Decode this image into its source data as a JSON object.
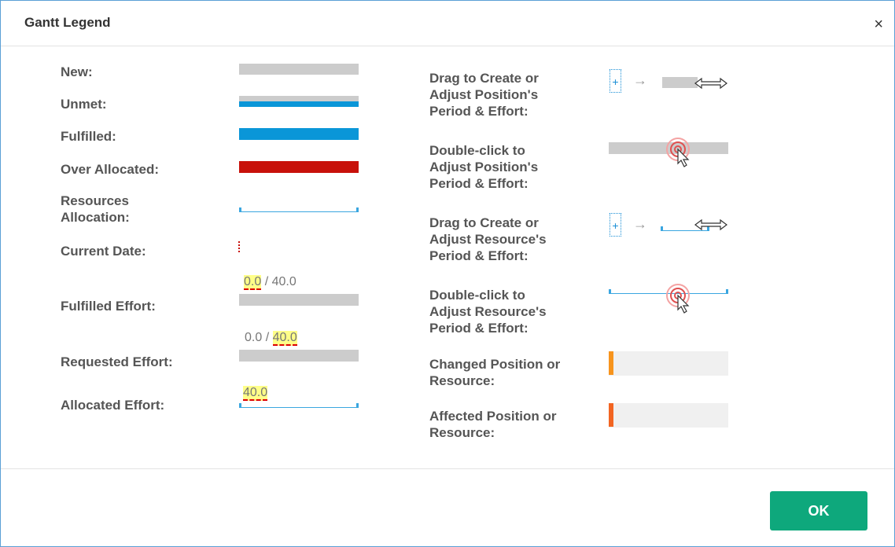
{
  "dialog": {
    "title": "Gantt Legend",
    "close_label": "×",
    "ok_label": "OK"
  },
  "left": {
    "new": "New:",
    "unmet": "Unmet:",
    "fulfilled": "Fulfilled:",
    "over_allocated": "Over Allocated:",
    "resources_allocation_1": "Resources",
    "resources_allocation_2": "Allocation:",
    "current_date": "Current Date:",
    "fulfilled_effort": "Fulfilled Effort:",
    "requested_effort": "Requested Effort:",
    "allocated_effort": "Allocated Effort:"
  },
  "effort": {
    "fulfilled_value": "0.0",
    "fulfilled_total": "/ 40.0",
    "requested_value": "0.0 /",
    "requested_total": "40.0",
    "allocated_value": "40.0"
  },
  "right": {
    "drag_position": [
      "Drag to Create or",
      "Adjust Position's",
      "Period & Effort:"
    ],
    "dblclick_position": [
      "Double-click to",
      "Adjust Position's",
      "Period & Effort:"
    ],
    "drag_resource": [
      "Drag to Create or",
      "Adjust Resource's",
      "Period & Effort:"
    ],
    "dblclick_resource": [
      "Double-click to",
      "Adjust Resource's",
      "Period & Effort:"
    ],
    "changed": [
      "Changed Position or",
      "Resource:"
    ],
    "affected": [
      "Affected Position or",
      "Resource:"
    ]
  },
  "colors": {
    "new": "#cccccc",
    "fulfilled": "#0a96d8",
    "over_allocated": "#c8110a",
    "changed_marker": "#f7941d",
    "affected_marker": "#f26522",
    "ok_button": "#0ea87c"
  },
  "icons": {
    "close": "close-icon",
    "plus": "plus-icon",
    "arrow": "right-arrow-icon",
    "resize": "resize-cursor-icon",
    "click": "double-click-target-icon"
  }
}
